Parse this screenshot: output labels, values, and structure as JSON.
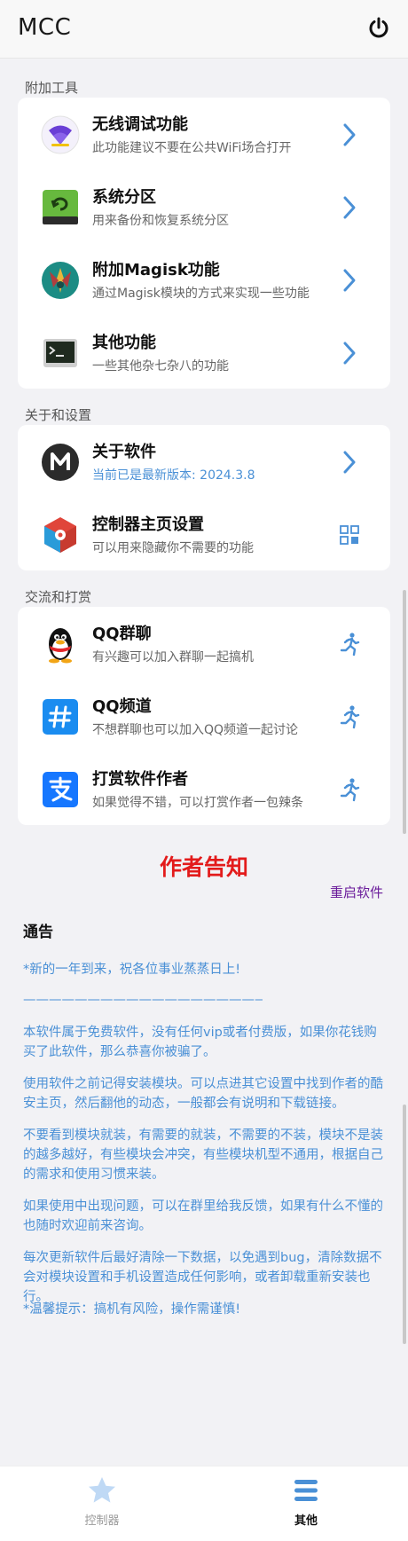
{
  "header": {
    "title": "MCC"
  },
  "sections": [
    {
      "title": "附加工具",
      "items": [
        {
          "title": "无线调试功能",
          "subtitle": "此功能建议不要在公共WiFi场合打开"
        },
        {
          "title": "系统分区",
          "subtitle": "用来备份和恢复系统分区"
        },
        {
          "title": "附加Magisk功能",
          "subtitle": "通过Magisk模块的方式来实现一些功能"
        },
        {
          "title": "其他功能",
          "subtitle": "一些其他杂七杂八的功能"
        }
      ]
    },
    {
      "title": "关于和设置",
      "items": [
        {
          "title": "关于软件",
          "subtitle": "当前已是最新版本: 2024.3.8"
        },
        {
          "title": "控制器主页设置",
          "subtitle": "可以用来隐藏你不需要的功能"
        }
      ]
    },
    {
      "title": "交流和打赏",
      "items": [
        {
          "title": "QQ群聊",
          "subtitle": "有兴趣可以加入群聊一起搞机"
        },
        {
          "title": "QQ频道",
          "subtitle": "不想群聊也可以加入QQ频道一起讨论"
        },
        {
          "title": "打赏软件作者",
          "subtitle": "如果觉得不错，可以打赏作者一包辣条"
        }
      ]
    }
  ],
  "notice": {
    "title": "作者告知",
    "restart_label": "重启软件",
    "heading": "通告",
    "paragraphs": [
      "*新的一年到来，祝各位事业蒸蒸日上!",
      "——————————————————————————",
      "本软件属于免费软件，没有任何vip或者付费版，如果你花钱购买了此软件，那么恭喜你被骗了。",
      "使用软件之前记得安装模块。可以点进其它设置中找到作者的酷安主页，然后翻他的动态，一般都会有说明和下载链接。",
      "不要看到模块就装，有需要的就装，不需要的不装，模块不是装的越多越好，有些模块会冲突，有些模块机型不通用，根据自己的需求和使用习惯来装。",
      "如果使用中出现问题，可以在群里给我反馈，如果有什么不懂的也随时欢迎前来咨询。",
      "每次更新软件后最好清除一下数据，以免遇到bug，清除数据不会对模块设置和手机设置造成任何影响，或者卸载重新安装也行。",
      "*温馨提示：搞机有风险，操作需谨慎!"
    ]
  },
  "bottom_nav": {
    "controller_label": "控制器",
    "other_label": "其他"
  },
  "colors": {
    "accent_blue": "#4a90d6",
    "notice_red": "#e31b1b",
    "restart_purple": "#6a1b9a"
  }
}
